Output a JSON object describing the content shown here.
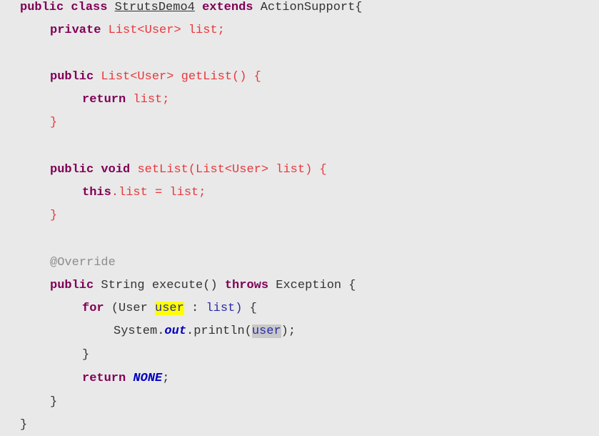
{
  "code": {
    "l1": {
      "public": "public",
      "class": "class",
      "classname": "StrutsDemo4",
      "extends": "extends",
      "parent": "ActionSupport{"
    },
    "l2": {
      "private": "private",
      "type": "List<User>",
      "name": "list;"
    },
    "l4": {
      "public": "public",
      "sig": "List<User> getList() {"
    },
    "l5": {
      "return": "return",
      "expr": "list;"
    },
    "l6": {
      "brace": "}"
    },
    "l8": {
      "public": "public",
      "void": "void",
      "sig": "setList(List<User> list) {"
    },
    "l9": {
      "this": "this",
      "expr": ".list = list;"
    },
    "l10": {
      "brace": "}"
    },
    "l12": {
      "annotation": "@Override"
    },
    "l13": {
      "public": "public",
      "sig": "String execute()",
      "throws": "throws",
      "exc": "Exception {"
    },
    "l14": {
      "for": "for",
      "open": "(User",
      "var": "user",
      "colon": ":",
      "list": "list)",
      "brace": "{"
    },
    "l15": {
      "sys": "System.",
      "out": "out",
      "println": ".println(",
      "arg": "user",
      "end": ");"
    },
    "l16": {
      "brace": "}"
    },
    "l17": {
      "return": "return",
      "none": "NONE",
      "semi": ";"
    },
    "l18": {
      "brace": "}"
    },
    "l19": {
      "brace": "}"
    }
  }
}
